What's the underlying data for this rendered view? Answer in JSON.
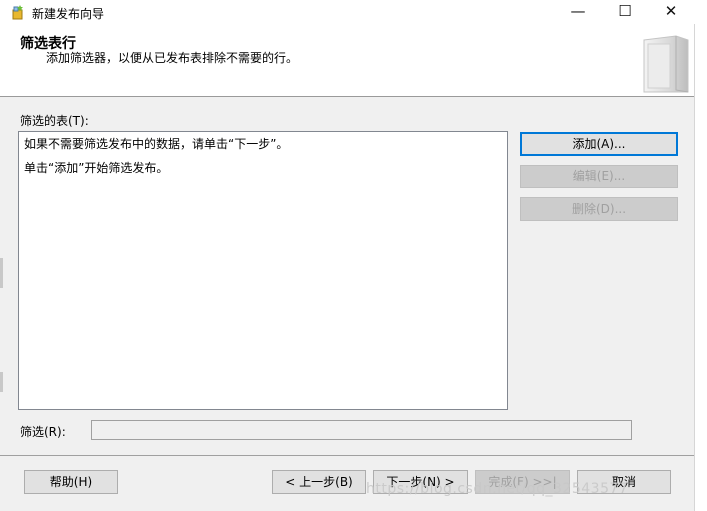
{
  "window": {
    "title": "新建发布向导",
    "minimize_glyph": "—",
    "maximize_glyph": "☐",
    "close_glyph": "✕"
  },
  "header": {
    "heading": "筛选表行",
    "description": "添加筛选器，以便从已发布表排除不需要的行。"
  },
  "body": {
    "tables_label": "筛选的表(T):",
    "list_lines": [
      "如果不需要筛选发布中的数据，请单击“下一步”。",
      "单击“添加”开始筛选发布。"
    ],
    "buttons": {
      "add": "添加(A)...",
      "edit": "编辑(E)...",
      "delete": "删除(D)..."
    },
    "filter_label": "筛选(R):",
    "filter_value": ""
  },
  "footer": {
    "help": "帮助(H)",
    "back": "< 上一步(B)",
    "next": "下一步(N) >",
    "finish": "完成(F) >>|",
    "cancel": "取消",
    "watermark": "https://blog.csdn.net/qq_32543577"
  },
  "colors": {
    "accent": "#0078d7",
    "panel": "#f0f0f0",
    "disabled_text": "#a0a0a0"
  }
}
